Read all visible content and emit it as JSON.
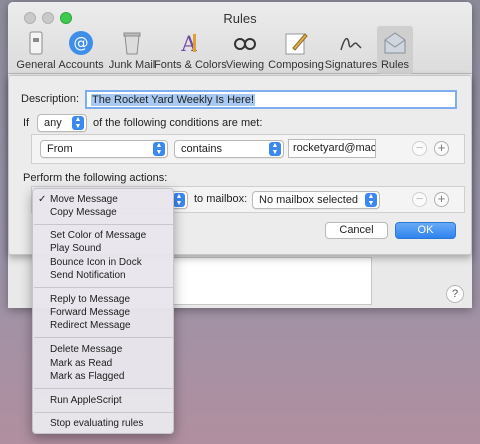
{
  "window": {
    "title": "Rules"
  },
  "toolbar": {
    "items": [
      {
        "label": "General",
        "icon": "general-icon"
      },
      {
        "label": "Accounts",
        "icon": "accounts-icon"
      },
      {
        "label": "Junk Mail",
        "icon": "junk-mail-icon"
      },
      {
        "label": "Fonts & Colors",
        "icon": "fonts-colors-icon"
      },
      {
        "label": "Viewing",
        "icon": "viewing-icon"
      },
      {
        "label": "Composing",
        "icon": "composing-icon"
      },
      {
        "label": "Signatures",
        "icon": "signatures-icon"
      },
      {
        "label": "Rules",
        "icon": "rules-icon",
        "selected": true
      }
    ]
  },
  "rule_sheet": {
    "description_label": "Description:",
    "description_value": "The Rocket Yard Weekly Is Here!",
    "if_label": "If",
    "match_value": "any",
    "conditions_suffix": "of the following conditions are met:",
    "condition": {
      "field": "From",
      "operator": "contains",
      "value": "rocketyard@macsa"
    },
    "actions_label": "Perform the following actions:",
    "action": {
      "to_mailbox_label": "to mailbox:",
      "mailbox_value": "No mailbox selected"
    },
    "cancel_label": "Cancel",
    "ok_label": "OK"
  },
  "action_menu": {
    "selected": "Move Message",
    "groups": [
      [
        "Move Message",
        "Copy Message"
      ],
      [
        "Set Color of Message",
        "Play Sound",
        "Bounce Icon in Dock",
        "Send Notification"
      ],
      [
        "Reply to Message",
        "Forward Message",
        "Redirect Message"
      ],
      [
        "Delete Message",
        "Mark as Read",
        "Mark as Flagged"
      ],
      [
        "Run AppleScript"
      ],
      [
        "Stop evaluating rules"
      ]
    ]
  },
  "help_label": "?",
  "colors": {
    "accent": "#3b89f0",
    "selection": "#a8c9f2",
    "ok_button": "#2f83ee"
  }
}
